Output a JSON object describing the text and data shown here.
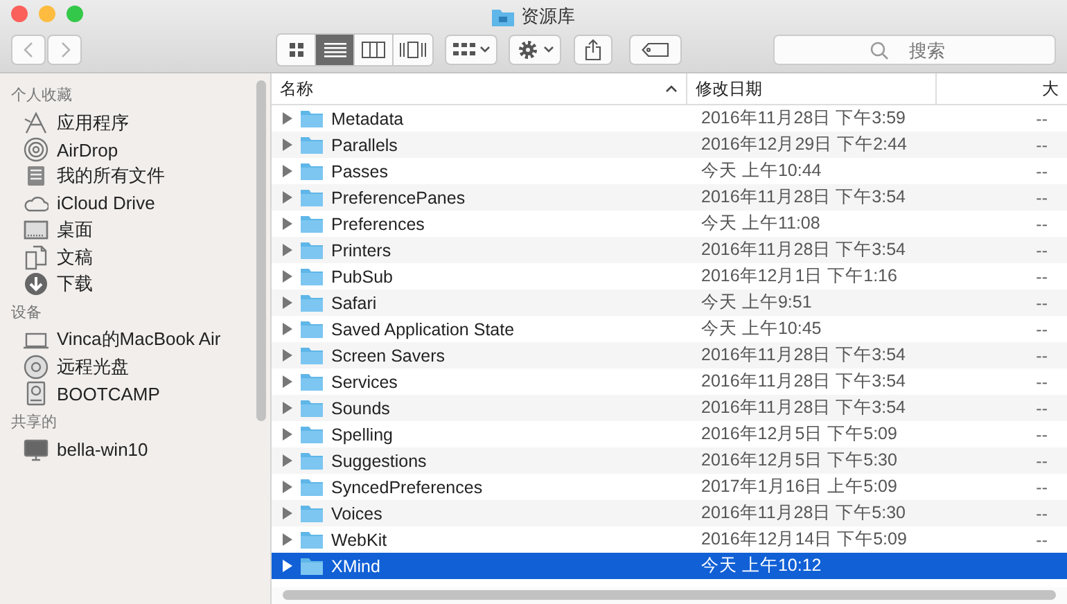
{
  "window": {
    "title": "资源库"
  },
  "view_modes": [
    {
      "kind": "icons",
      "selected": false
    },
    {
      "kind": "list",
      "selected": true
    },
    {
      "kind": "columns",
      "selected": false
    },
    {
      "kind": "coverflow",
      "selected": false
    }
  ],
  "search": {
    "placeholder": "搜索"
  },
  "sidebar": [
    {
      "heading": "个人收藏",
      "items": [
        {
          "kind": "apps",
          "label": "应用程序"
        },
        {
          "kind": "airdrop",
          "label": "AirDrop"
        },
        {
          "kind": "allfiles",
          "label": "我的所有文件"
        },
        {
          "kind": "cloud",
          "label": "iCloud Drive"
        },
        {
          "kind": "desktop",
          "label": "桌面"
        },
        {
          "kind": "docs",
          "label": "文稿"
        },
        {
          "kind": "download",
          "label": "下载"
        }
      ]
    },
    {
      "heading": "设备",
      "items": [
        {
          "kind": "laptop",
          "label": "Vinca的MacBook Air"
        },
        {
          "kind": "disc",
          "label": "远程光盘"
        },
        {
          "kind": "disk",
          "label": "BOOTCAMP"
        }
      ]
    },
    {
      "heading": "共享的",
      "items": [
        {
          "kind": "monitor",
          "label": "bella-win10"
        }
      ]
    }
  ],
  "table": {
    "columns": [
      {
        "label": "名称",
        "sorted": true
      },
      {
        "label": "修改日期",
        "sorted": false
      },
      {
        "label": "大",
        "sorted": false
      }
    ],
    "rows": [
      {
        "name": "Metadata",
        "date": "2016年11月28日 下午3:59",
        "size": "--",
        "selected": false
      },
      {
        "name": "Parallels",
        "date": "2016年12月29日 下午2:44",
        "size": "--",
        "selected": false
      },
      {
        "name": "Passes",
        "date": "今天 上午10:44",
        "size": "--",
        "selected": false
      },
      {
        "name": "PreferencePanes",
        "date": "2016年11月28日 下午3:54",
        "size": "--",
        "selected": false
      },
      {
        "name": "Preferences",
        "date": "今天 上午11:08",
        "size": "--",
        "selected": false
      },
      {
        "name": "Printers",
        "date": "2016年11月28日 下午3:54",
        "size": "--",
        "selected": false
      },
      {
        "name": "PubSub",
        "date": "2016年12月1日 下午1:16",
        "size": "--",
        "selected": false
      },
      {
        "name": "Safari",
        "date": "今天 上午9:51",
        "size": "--",
        "selected": false
      },
      {
        "name": "Saved Application State",
        "date": "今天 上午10:45",
        "size": "--",
        "selected": false
      },
      {
        "name": "Screen Savers",
        "date": "2016年11月28日 下午3:54",
        "size": "--",
        "selected": false
      },
      {
        "name": "Services",
        "date": "2016年11月28日 下午3:54",
        "size": "--",
        "selected": false
      },
      {
        "name": "Sounds",
        "date": "2016年11月28日 下午3:54",
        "size": "--",
        "selected": false
      },
      {
        "name": "Spelling",
        "date": "2016年12月5日 下午5:09",
        "size": "--",
        "selected": false
      },
      {
        "name": "Suggestions",
        "date": "2016年12月5日 下午5:30",
        "size": "--",
        "selected": false
      },
      {
        "name": "SyncedPreferences",
        "date": "2017年1月16日 上午5:09",
        "size": "--",
        "selected": false
      },
      {
        "name": "Voices",
        "date": "2016年11月28日 下午5:30",
        "size": "--",
        "selected": false
      },
      {
        "name": "WebKit",
        "date": "2016年12月14日 下午5:09",
        "size": "--",
        "selected": false
      },
      {
        "name": "XMind",
        "date": "今天 上午10:12",
        "size": "",
        "selected": true
      }
    ]
  }
}
